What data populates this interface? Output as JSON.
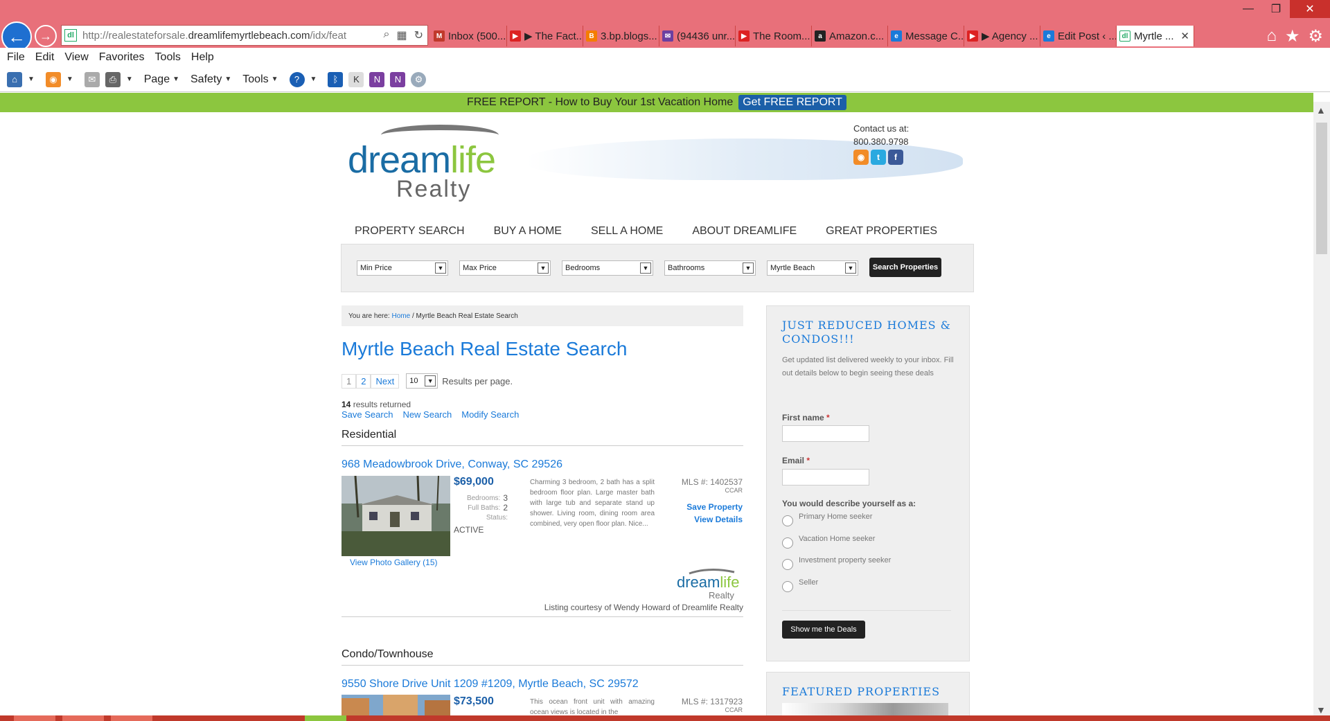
{
  "browser": {
    "url_prefix": "http://realestateforsale.",
    "url_domain": "dreamlifemyrtlebeach.com",
    "url_suffix": "/idx/feat",
    "tabs": [
      {
        "label": "Inbox (500...",
        "icon_color": "#c0392b",
        "icon": "mail-icon"
      },
      {
        "label": "▶ The Fact...",
        "icon_color": "#d22",
        "icon": "youtube-icon"
      },
      {
        "label": "3.bp.blogs...",
        "icon_color": "#f57d00",
        "icon": "blogger-icon"
      },
      {
        "label": "(94436 unr...",
        "icon_color": "#6b3fa0",
        "icon": "yahoo-mail-icon"
      },
      {
        "label": "The Room...",
        "icon_color": "#d22",
        "icon": "youtube-icon"
      },
      {
        "label": "Amazon.c...",
        "icon_color": "#222",
        "icon": "amazon-icon"
      },
      {
        "label": "Message C...",
        "icon_color": "#1a7ad9",
        "icon": "ie-icon"
      },
      {
        "label": "▶ Agency ...",
        "icon_color": "#d22",
        "icon": "youtube-icon"
      },
      {
        "label": "Edit Post ‹ ...",
        "icon_color": "#1a7ad9",
        "icon": "ie-icon"
      },
      {
        "label": "Myrtle ...",
        "icon_color": "#2a6",
        "icon": "dreamlife-icon"
      }
    ],
    "menu": [
      "File",
      "Edit",
      "View",
      "Favorites",
      "Tools",
      "Help"
    ],
    "commands": {
      "page": "Page",
      "safety": "Safety",
      "tools": "Tools"
    }
  },
  "promo": {
    "text": "FREE REPORT - How to Buy Your 1st Vacation Home",
    "button": "Get FREE REPORT"
  },
  "logo": {
    "dream": "dream",
    "life": "life",
    "realty": "Realty"
  },
  "contact": {
    "label": "Contact us at:",
    "phone": "800.380.9798"
  },
  "nav": [
    "PROPERTY SEARCH",
    "BUY A HOME",
    "SELL A HOME",
    "ABOUT DREAMLIFE",
    "GREAT PROPERTIES"
  ],
  "search": {
    "min_price": "Min Price",
    "max_price": "Max Price",
    "bedrooms": "Bedrooms",
    "bathrooms": "Bathrooms",
    "city": "Myrtle Beach",
    "button": "Search Properties"
  },
  "breadcrumb": {
    "prefix": "You are here:",
    "home": "Home",
    "current": "/ Myrtle Beach Real Estate Search"
  },
  "page_title": "Myrtle Beach Real Estate Search",
  "pager": {
    "p1": "1",
    "p2": "2",
    "next": "Next",
    "per_page": "10",
    "per_page_label": "Results per page."
  },
  "results": {
    "count": "14",
    "label": "results returned",
    "links": [
      "Save Search",
      "New Search",
      "Modify Search"
    ]
  },
  "sections": {
    "residential": "Residential",
    "condo": "Condo/Townhouse"
  },
  "listings": [
    {
      "title": "968 Meadowbrook Drive, Conway, SC 29526",
      "price": "$69,000",
      "bedrooms_label": "Bedrooms:",
      "bedrooms": "3",
      "baths_label": "Full Baths:",
      "baths": "2",
      "status_label": "Status:",
      "status": "ACTIVE",
      "description": "Charming 3 bedroom, 2 bath has a split bedroom floor plan. Large master bath with large tub and separate stand up shower. Living room, dining room area combined, very open floor plan. Nice...",
      "mls": "MLS #: 1402537",
      "mls_source": "CCAR",
      "save": "Save Property",
      "details": "View Details",
      "gallery": "View Photo Gallery (15)",
      "courtesy": "Listing courtesy of Wendy Howard of Dreamlife Realty"
    },
    {
      "title": "9550 Shore Drive Unit 1209 #1209, Myrtle Beach, SC 29572",
      "price": "$73,500",
      "description": "This ocean front unit with amazing ocean views is located in the",
      "mls": "MLS #: 1317923",
      "mls_source": "CCAR"
    }
  ],
  "sidebar": {
    "title": "JUST REDUCED HOMES & CONDOS!!!",
    "intro": "Get updated list delivered weekly to your inbox. Fill out details below to begin seeing these deals",
    "first_name": "First name",
    "email": "Email",
    "required": "*",
    "describe": "You would describe yourself as a:",
    "options": [
      "Primary Home seeker",
      "Vacation Home seeker",
      "Investment property seeker",
      "Seller"
    ],
    "button": "Show me the Deals",
    "featured": "FEATURED PROPERTIES"
  }
}
